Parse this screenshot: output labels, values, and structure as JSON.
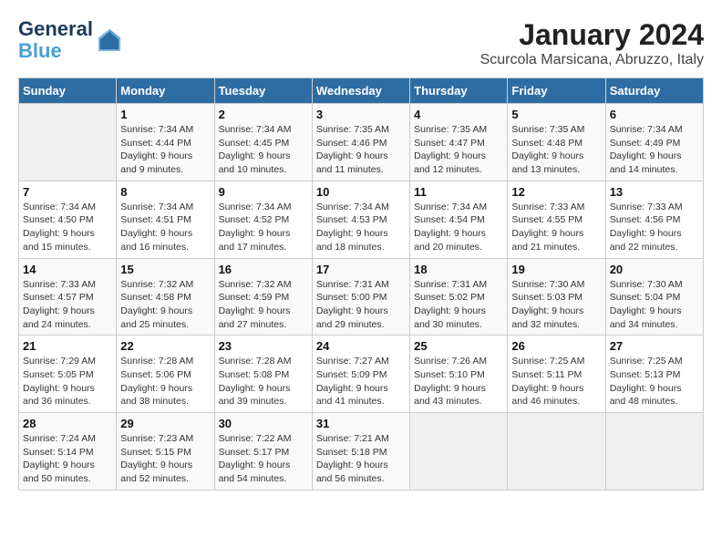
{
  "header": {
    "logo_line1": "General",
    "logo_line2": "Blue",
    "title": "January 2024",
    "subtitle": "Scurcola Marsicana, Abruzzo, Italy"
  },
  "days_of_week": [
    "Sunday",
    "Monday",
    "Tuesday",
    "Wednesday",
    "Thursday",
    "Friday",
    "Saturday"
  ],
  "weeks": [
    [
      {
        "day": "",
        "info": ""
      },
      {
        "day": "1",
        "info": "Sunrise: 7:34 AM\nSunset: 4:44 PM\nDaylight: 9 hours\nand 9 minutes."
      },
      {
        "day": "2",
        "info": "Sunrise: 7:34 AM\nSunset: 4:45 PM\nDaylight: 9 hours\nand 10 minutes."
      },
      {
        "day": "3",
        "info": "Sunrise: 7:35 AM\nSunset: 4:46 PM\nDaylight: 9 hours\nand 11 minutes."
      },
      {
        "day": "4",
        "info": "Sunrise: 7:35 AM\nSunset: 4:47 PM\nDaylight: 9 hours\nand 12 minutes."
      },
      {
        "day": "5",
        "info": "Sunrise: 7:35 AM\nSunset: 4:48 PM\nDaylight: 9 hours\nand 13 minutes."
      },
      {
        "day": "6",
        "info": "Sunrise: 7:34 AM\nSunset: 4:49 PM\nDaylight: 9 hours\nand 14 minutes."
      }
    ],
    [
      {
        "day": "7",
        "info": "Sunrise: 7:34 AM\nSunset: 4:50 PM\nDaylight: 9 hours\nand 15 minutes."
      },
      {
        "day": "8",
        "info": "Sunrise: 7:34 AM\nSunset: 4:51 PM\nDaylight: 9 hours\nand 16 minutes."
      },
      {
        "day": "9",
        "info": "Sunrise: 7:34 AM\nSunset: 4:52 PM\nDaylight: 9 hours\nand 17 minutes."
      },
      {
        "day": "10",
        "info": "Sunrise: 7:34 AM\nSunset: 4:53 PM\nDaylight: 9 hours\nand 18 minutes."
      },
      {
        "day": "11",
        "info": "Sunrise: 7:34 AM\nSunset: 4:54 PM\nDaylight: 9 hours\nand 20 minutes."
      },
      {
        "day": "12",
        "info": "Sunrise: 7:33 AM\nSunset: 4:55 PM\nDaylight: 9 hours\nand 21 minutes."
      },
      {
        "day": "13",
        "info": "Sunrise: 7:33 AM\nSunset: 4:56 PM\nDaylight: 9 hours\nand 22 minutes."
      }
    ],
    [
      {
        "day": "14",
        "info": "Sunrise: 7:33 AM\nSunset: 4:57 PM\nDaylight: 9 hours\nand 24 minutes."
      },
      {
        "day": "15",
        "info": "Sunrise: 7:32 AM\nSunset: 4:58 PM\nDaylight: 9 hours\nand 25 minutes."
      },
      {
        "day": "16",
        "info": "Sunrise: 7:32 AM\nSunset: 4:59 PM\nDaylight: 9 hours\nand 27 minutes."
      },
      {
        "day": "17",
        "info": "Sunrise: 7:31 AM\nSunset: 5:00 PM\nDaylight: 9 hours\nand 29 minutes."
      },
      {
        "day": "18",
        "info": "Sunrise: 7:31 AM\nSunset: 5:02 PM\nDaylight: 9 hours\nand 30 minutes."
      },
      {
        "day": "19",
        "info": "Sunrise: 7:30 AM\nSunset: 5:03 PM\nDaylight: 9 hours\nand 32 minutes."
      },
      {
        "day": "20",
        "info": "Sunrise: 7:30 AM\nSunset: 5:04 PM\nDaylight: 9 hours\nand 34 minutes."
      }
    ],
    [
      {
        "day": "21",
        "info": "Sunrise: 7:29 AM\nSunset: 5:05 PM\nDaylight: 9 hours\nand 36 minutes."
      },
      {
        "day": "22",
        "info": "Sunrise: 7:28 AM\nSunset: 5:06 PM\nDaylight: 9 hours\nand 38 minutes."
      },
      {
        "day": "23",
        "info": "Sunrise: 7:28 AM\nSunset: 5:08 PM\nDaylight: 9 hours\nand 39 minutes."
      },
      {
        "day": "24",
        "info": "Sunrise: 7:27 AM\nSunset: 5:09 PM\nDaylight: 9 hours\nand 41 minutes."
      },
      {
        "day": "25",
        "info": "Sunrise: 7:26 AM\nSunset: 5:10 PM\nDaylight: 9 hours\nand 43 minutes."
      },
      {
        "day": "26",
        "info": "Sunrise: 7:25 AM\nSunset: 5:11 PM\nDaylight: 9 hours\nand 46 minutes."
      },
      {
        "day": "27",
        "info": "Sunrise: 7:25 AM\nSunset: 5:13 PM\nDaylight: 9 hours\nand 48 minutes."
      }
    ],
    [
      {
        "day": "28",
        "info": "Sunrise: 7:24 AM\nSunset: 5:14 PM\nDaylight: 9 hours\nand 50 minutes."
      },
      {
        "day": "29",
        "info": "Sunrise: 7:23 AM\nSunset: 5:15 PM\nDaylight: 9 hours\nand 52 minutes."
      },
      {
        "day": "30",
        "info": "Sunrise: 7:22 AM\nSunset: 5:17 PM\nDaylight: 9 hours\nand 54 minutes."
      },
      {
        "day": "31",
        "info": "Sunrise: 7:21 AM\nSunset: 5:18 PM\nDaylight: 9 hours\nand 56 minutes."
      },
      {
        "day": "",
        "info": ""
      },
      {
        "day": "",
        "info": ""
      },
      {
        "day": "",
        "info": ""
      }
    ]
  ]
}
